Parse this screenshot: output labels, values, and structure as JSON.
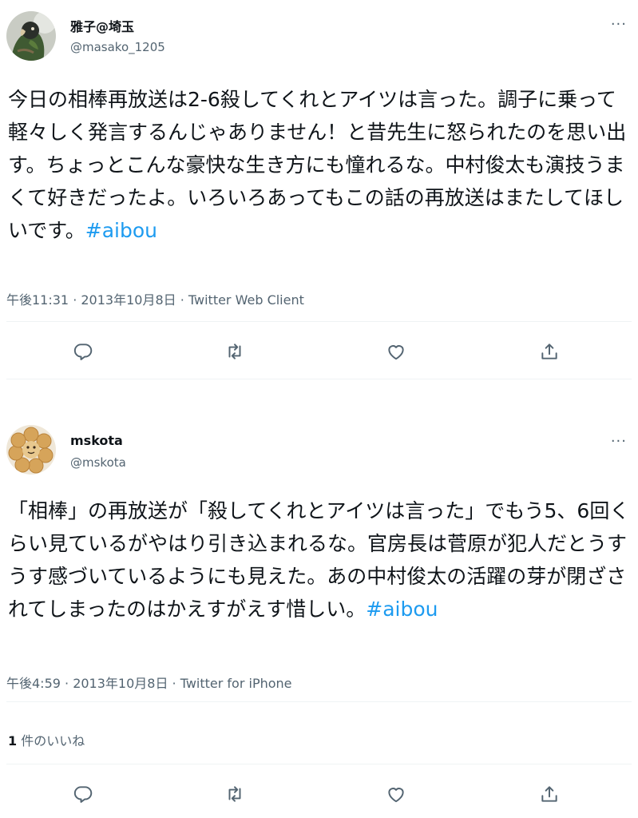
{
  "tweets": [
    {
      "name": "雅子@埼玉",
      "handle": "@masako_1205",
      "body_text": "今日の相棒再放送は2-6殺してくれとアイツは言った。調子に乗って軽々しく発言するんじゃありません！と昔先生に怒られたのを思い出す。ちょっとこんな豪快な生き方にも憧れるな。中村俊太も演技うまくて好きだったよ。いろいろあってもこの話の再放送はまたしてほしいです。",
      "hashtag": "#aibou",
      "meta": "午後11:31 · 2013年10月8日 · Twitter Web Client",
      "more": "···"
    },
    {
      "name": "mskota",
      "handle": "@mskota",
      "body_text": "「相棒」の再放送が「殺してくれとアイツは言った」でもう5、6回くらい見ているがやはり引き込まれるな。官房長は菅原が犯人だとうすうす感づいているようにも見えた。あの中村俊太の活躍の芽が閉ざされてしまったのはかえすがえす惜しい。",
      "hashtag": "#aibou",
      "meta": "午後4:59 · 2013年10月8日 · Twitter for iPhone",
      "more": "···",
      "likes_count": "1",
      "likes_label": " 件のいいね"
    }
  ],
  "icons": {
    "reply": "reply-icon",
    "retweet": "retweet-icon",
    "like": "heart-icon",
    "share": "share-icon"
  },
  "colors": {
    "hashtag": "#1d9bf0",
    "secondary_text": "#536471",
    "primary_text": "#0f1419"
  }
}
